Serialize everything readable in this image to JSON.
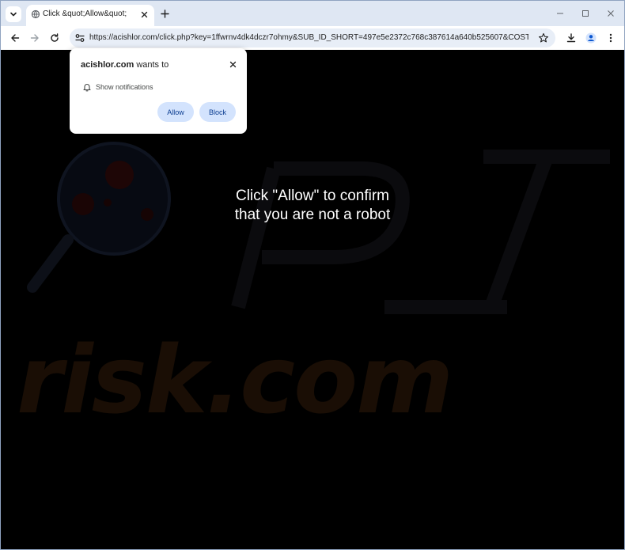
{
  "browser": {
    "tab": {
      "title": "Click &quot;Allow&quot;"
    },
    "address_bar": {
      "url": "https://acishlor.com/click.php?key=1ffwrnv4dk4dczr7ohmy&SUB_ID_SHORT=497e5e2372c768c387614a640b525607&COST_CP..."
    }
  },
  "permission_popup": {
    "site": "acishlor.com",
    "wants_to": " wants to",
    "permission": "Show notifications",
    "allow_label": "Allow",
    "block_label": "Block"
  },
  "page": {
    "message_line1": "Click \"Allow\" to confirm",
    "message_line2": "that you are not a robot"
  },
  "watermark": {
    "text": "risk.com"
  },
  "colors": {
    "tabstrip": "#dfe7f3",
    "omnibox": "#e8eef7",
    "button_bg": "#d3e3fd",
    "page_bg": "#000000"
  }
}
